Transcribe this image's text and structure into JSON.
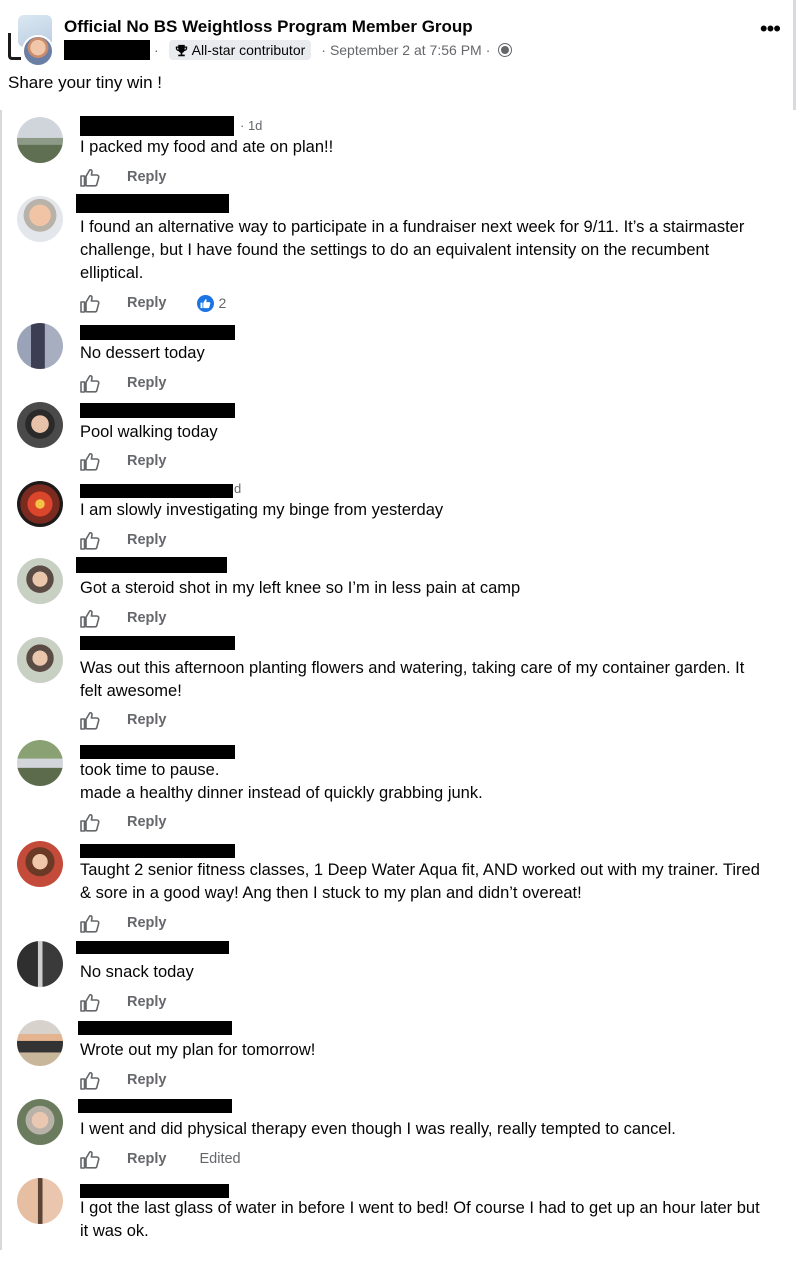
{
  "post": {
    "group_name": "Official No BS Weightloss Program Member Group",
    "badge": "All-star contributor",
    "timestamp": "September 2 at 7:56 PM",
    "text": "Share your tiny win !"
  },
  "actions": {
    "reply": "Reply",
    "edited": "Edited"
  },
  "comments": [
    {
      "age": "· 1d",
      "text": "I packed my food and ate on plan!!"
    },
    {
      "text": "I found an alternative way to participate in a fundraiser next week for 9/11. It’s a stairmaster challenge, but I have found the settings to do an equivalent intensity on the recumbent elliptical.",
      "reaction_count": "2"
    },
    {
      "text": "No dessert today"
    },
    {
      "text": "Pool walking today"
    },
    {
      "age": "d",
      "text": "I am slowly investigating my binge from yesterday"
    },
    {
      "text": "Got a steroid shot in my left knee so I’m in less pain at camp"
    },
    {
      "text": "Was out this afternoon planting flowers and watering, taking care of my container garden. It felt awesome!"
    },
    {
      "line1": "took time to pause.",
      "line2": "made a healthy dinner instead of quickly grabbing junk."
    },
    {
      "text": "Taught 2 senior fitness classes, 1 Deep Water Aqua fit, AND worked out with my trainer. Tired & sore in a good way! Ang then I stuck to my plan and didn’t overeat!"
    },
    {
      "text": "No snack today"
    },
    {
      "text": "Wrote out my plan for tomorrow!"
    },
    {
      "text": "I went and did physical therapy even though I was really, really tempted to cancel."
    },
    {
      "text": "I got the last glass of water in before I went to bed! Of course I had to get up an hour later but it was ok."
    }
  ]
}
